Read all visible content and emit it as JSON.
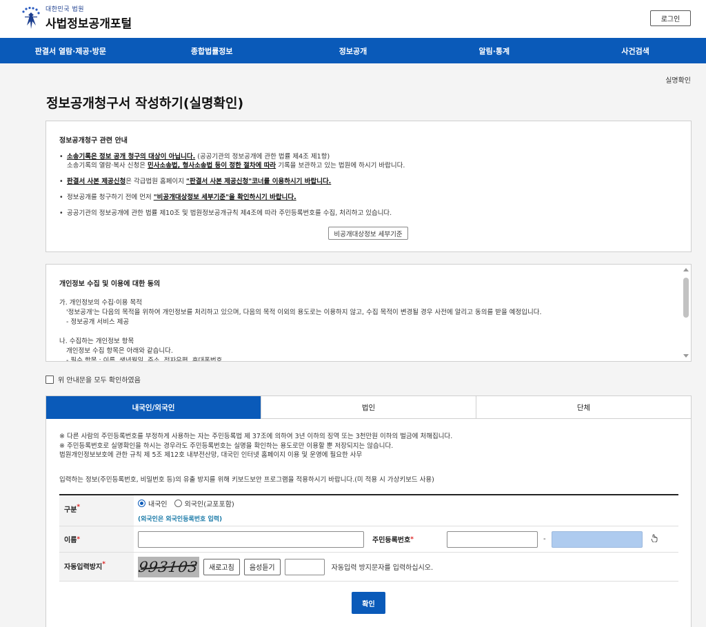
{
  "header": {
    "logo_sub": "대한민국 법원",
    "logo_main": "사법정보공개포털",
    "login_label": "로그인"
  },
  "gnb": [
    "판결서 열람·제공·방문",
    "종합법률정보",
    "정보공개",
    "알림·통계",
    "사건검색"
  ],
  "breadcrumb": "실명확인",
  "page_title": "정보공개청구서 작성하기(실명확인)",
  "notice": {
    "title": "정보공개청구 관련 안내",
    "b1_u": "소송기록은 정보 공개 청구의 대상이 아닙니다.",
    "b1_tail": " (공공기관의 정보공개에 관한 법률 제4조 제1항)",
    "b1_line2_a": "소송기록의 열람·복사 신청은 ",
    "b1_line2_u": "민사소송법, 형사소송법 등이 정한 절차에 따라",
    "b1_line2_b": " 기록을 보관하고 있는 법원에 하시기 바랍니다.",
    "b2_u1": "판결서 사본 제공신청",
    "b2_mid": "은 각급법원 홈페이지 ",
    "b2_u2": "\"판결서 사본 제공신청\"코너를 이용하시기 바랍니다.",
    "b3_a": "정보공개를 청구하기 전에 먼저 ",
    "b3_u": "\"비공개대상정보 세부기준\"을 확인하시기 바랍니다.",
    "b4": "공공기관의 정보공개에 관한 법률 제10조 및 법원정보공개규칙 제4조에 따라 주민등록번호를 수집, 처리하고 있습니다.",
    "button": "비공개대상정보 세부기준"
  },
  "privacy": {
    "title": "개인정보 수집 및 이용에 대한 동의",
    "lines": [
      "가. 개인정보의 수집·이용 목적",
      "  '정보공개'는 다음의 목적을 위하여 개인정보를 처리하고 있으며, 다음의 목적 이외의 용도로는 이용하지 않고, 수집 목적이 변경될 경우 사전에 알리고 동의를 받을 예정입니다.",
      "  - 정보공개 서비스 제공",
      "",
      "나. 수집하는 개인정보 항목",
      "    개인정보 수집 항목은 아래와 같습니다.",
      "  - 필수 항목 : 이름, 생년월일, 주소, 전자우편, 휴대폰번호"
    ]
  },
  "agree_label": "위 안내문을 모두 확인하였음",
  "tabs": [
    "내국인/외국인",
    "법인",
    "단체"
  ],
  "panel_notes": [
    "※ 다른 사람의 주민등록번호를 부정하게 사용하는 자는 주민등록법 제 37조에 의하여 3년 이하의 징역 또는 3천만원 이하의 벌금에 처해집니다.",
    "※ 주민등록번호로 실명확인을 하시는 경우라도 주민등록번호는 실명을 확인하는 용도로만 이용할 뿐 저장되지는 않습니다.",
    "법원개인정보보호에 관한 규칙 제 5조 제12호 내부전산망, 대국민 인터넷 홈페이지 이용 및 운영에 필요한 사무"
  ],
  "keyboard_note": "입력하는 정보(주민등록번호, 비밀번호 등)의 유출 방지를 위해 키보드보안 프로그램을 적용하시기 바랍니다.(미 적용 시 가상키보드 사용)",
  "form": {
    "type_label": "구분",
    "type_opt1": "내국인",
    "type_opt2": "외국인(교포포함)",
    "type_hint": "(외국인은 외국인등록번호 입력)",
    "name_label": "이름",
    "rrn_label": "주민등록번호",
    "rrn_sep": "-",
    "captcha_label": "자동입력방지",
    "captcha_text": "993103",
    "refresh_label": "새로고침",
    "audio_label": "음성듣기",
    "captcha_help": "자동입력 방지문자를 입력하십시오.",
    "confirm_label": "확인"
  },
  "colors": {
    "brand": "#0a5ab9",
    "hint": "#1a7aa8",
    "required": "#d22222"
  }
}
